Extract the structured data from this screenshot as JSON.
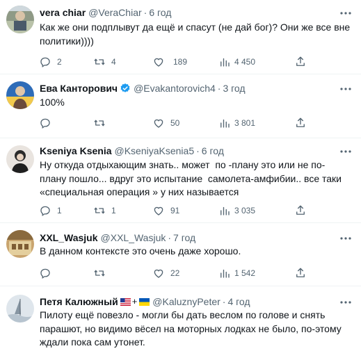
{
  "tweets": [
    {
      "name": "vera chiar",
      "handle": "@VeraChiar",
      "dot": "·",
      "time": "6 год",
      "text": "Как же они подплывут да ещё и спасут (не дай бог)? Они же все вне политики))))",
      "replies": "2",
      "retweets": "4",
      "likes": "",
      "views": "189",
      "bookmarks": "4 450"
    },
    {
      "name": "Ева Канторович",
      "handle": "@Evakantorovich4",
      "dot": "·",
      "time": "3 год",
      "text": "100%",
      "replies": "",
      "retweets": "",
      "likes": "50",
      "views": "3 801",
      "bookmarks": ""
    },
    {
      "name": "Kseniya Ksenia",
      "handle": "@KseniyaKsenia5",
      "dot": "·",
      "time": "6 год",
      "text": "Ну откуда отдыхающим знать.. может  по -плану это или не по-плану пошло... вдруг это испытание  самолета-амфибии.. все таки «специальная операция » у них называется",
      "replies": "1",
      "retweets": "1",
      "likes": "91",
      "views": "3 035",
      "bookmarks": ""
    },
    {
      "name": "XXL_Wasjuk",
      "handle": "@XXL_Wasjuk",
      "dot": "·",
      "time": "7 год",
      "text": "В данном контексте это очень даже хорошо.",
      "replies": "",
      "retweets": "",
      "likes": "22",
      "views": "1 542",
      "bookmarks": ""
    },
    {
      "name": "Петя Калюжный",
      "plus": "+",
      "handle": "@KaluznyPeter",
      "dot": "·",
      "time": "4 год",
      "text": "Пилоту ещё повезло - могли бы дать веслом по голове и снять парашют, но видимо вёсел на моторных лодках не было, по-этому ждали пока сам утонет."
    }
  ],
  "colors": {
    "text": "#0f1419",
    "secondary": "#536471",
    "verified": "#1d9bf0",
    "divider": "#eff3f4"
  },
  "icons": [
    "more-icon",
    "reply-icon",
    "retweet-icon",
    "like-icon",
    "views-icon",
    "share-icon",
    "verified-badge-icon",
    "us-flag-icon",
    "ukraine-flag-icon"
  ]
}
